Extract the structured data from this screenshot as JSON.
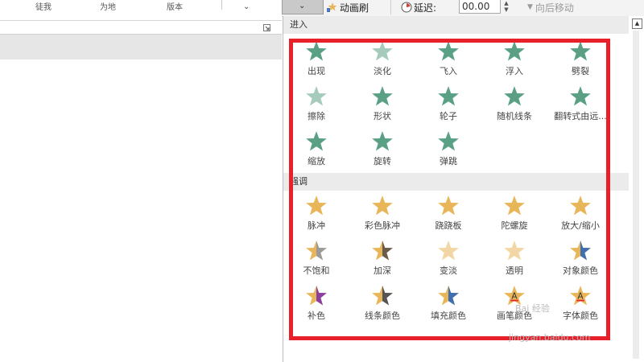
{
  "ribbon": {
    "partial_labels": [
      "徒我",
      "为地",
      "版本"
    ],
    "chevron": "⌄",
    "launcher_icon": "dialog-launcher-icon"
  },
  "toolbar": {
    "dropdown_caret": "⌄",
    "animation_painter": "动画刷",
    "delay_label": "延迟:",
    "delay_value": "00.00",
    "move_later": "向后移动"
  },
  "colors": {
    "entrance_green": "#5aa084",
    "emphasis_gold": "#e8b659",
    "highlight_red": "#e8202a"
  },
  "gallery": {
    "entrance": {
      "title": "进入",
      "items": [
        "出现",
        "淡化",
        "飞入",
        "浮入",
        "劈裂",
        "擦除",
        "形状",
        "轮子",
        "随机线条",
        "翻转式由远...",
        "缩放",
        "旋转",
        "弹跳"
      ]
    },
    "emphasis": {
      "title": "强调",
      "items": [
        "脉冲",
        "彩色脉冲",
        "跷跷板",
        "陀螺旋",
        "放大/缩小",
        "不饱和",
        "加深",
        "变淡",
        "透明",
        "对象颜色",
        "补色",
        "线条颜色",
        "填充颜色",
        "画笔颜色",
        "字体颜色"
      ]
    }
  },
  "watermark": {
    "text": "Bai 经验",
    "url": "jingyan.baidu.com"
  }
}
